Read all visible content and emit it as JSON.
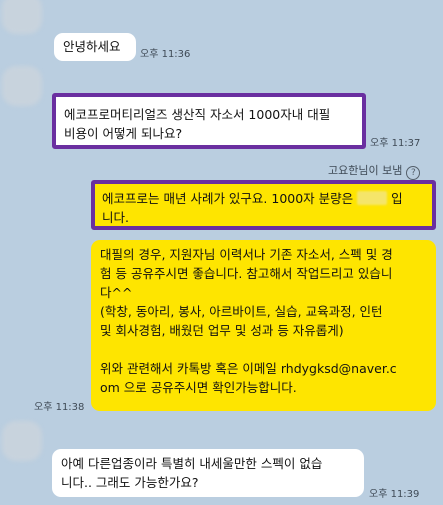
{
  "messages": [
    {
      "id": "m1",
      "side": "left",
      "text": "안녕하세요",
      "time": "오후 11:36"
    },
    {
      "id": "m2",
      "side": "left",
      "lines": [
        "에코프로머티리얼즈 생산직 자소서 1000자내 대필",
        "비용이 어떻게 되나요?"
      ],
      "time": "오후 11:37"
    },
    {
      "id": "m3",
      "side": "right",
      "sender_note": "고요한님이 보냄",
      "lines_pre": "에코프로는 매년 사례가 있구요. 1000자 분량은 ",
      "line_post": " 입",
      "line2": "니다."
    },
    {
      "id": "m4",
      "side": "right",
      "lines": [
        "대필의 경우, 지원자님 이력서나 기존 자소서, 스펙 및 경",
        "험 등 공유주시면 좋습니다. 참고해서 작업드리고 있습니",
        "다^^",
        "(학창, 동아리, 봉사, 아르바이트, 실습, 교육과정, 인턴",
        "및 회사경험, 배웠던 업무 및 성과 등 자유롭게)",
        "",
        "위와 관련해서 카톡방 혹은 이메일 rhdygksd@naver.c",
        "om 으로 공유주시면 확인가능합니다."
      ],
      "time": "오후 11:38"
    },
    {
      "id": "m5",
      "side": "left",
      "lines": [
        "아예 다른업종이라 특별히 내세울만한 스펙이 없습",
        "니다.. 그래도 가능한가요?"
      ],
      "time": "오후 11:39"
    }
  ],
  "colors": {
    "background": "#bacee0",
    "bubble_yellow": "#fee500",
    "bubble_white": "#ffffff",
    "highlight_border": "#6a2fa0"
  },
  "icons": {
    "info": "info-icon",
    "help_glyph": "?"
  }
}
